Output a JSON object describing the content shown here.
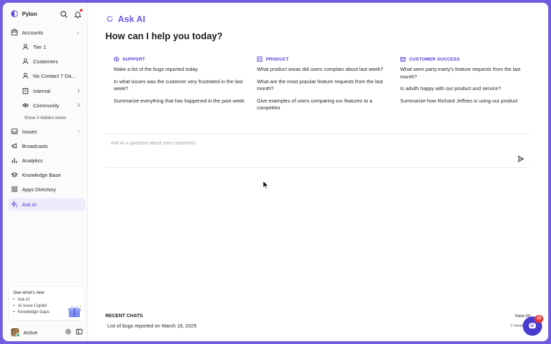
{
  "app": {
    "name": "Pylon"
  },
  "sidebar": {
    "items": [
      {
        "label": "Accounts"
      },
      {
        "label": "Tier 1"
      },
      {
        "label": "Customers"
      },
      {
        "label": "No Contact 7 Da..."
      },
      {
        "label": "Internal",
        "count": "1"
      },
      {
        "label": "Community",
        "count": "3"
      },
      {
        "label": "Issues"
      },
      {
        "label": "Broadcasts"
      },
      {
        "label": "Analytics"
      },
      {
        "label": "Knowledge Base"
      },
      {
        "label": "Apps Directory"
      },
      {
        "label": "Ask AI"
      }
    ],
    "hidden_views": "Show 3 hidden views",
    "whats_new": {
      "title": "See what's new",
      "items": [
        "Ask AI",
        "AI Issue Copilot",
        "Knowledge Gaps"
      ]
    },
    "user": {
      "status": "Active"
    }
  },
  "main": {
    "title": "Ask AI",
    "headline": "How can I help you today?",
    "columns": [
      {
        "heading": "SUPPORT",
        "questions": [
          "Make a list of the bugs reported today",
          "In what issues was the customer very frustrated in the last week?",
          "Summarize everything that has happened in the past week"
        ]
      },
      {
        "heading": "PRODUCT",
        "questions": [
          "What product areas did users complain about last week?",
          "What are the most popular feature requests from the last month?",
          "Give examples of users comparing our features to a competitor"
        ]
      },
      {
        "heading": "CUSTOMER SUCCESS",
        "questions": [
          "What were party.marty's feature requests from the last month?",
          "Is advith happy with our product and service?",
          "Summarize how Richard Jeffries is using our product"
        ]
      }
    ],
    "ask_placeholder": "Ask AI a question about your customers",
    "recent": {
      "title": "RECENT CHATS",
      "view_all": "View All",
      "items": [
        {
          "title": "List of bugs reported on March 19, 2025",
          "time": "2 weeks a"
        }
      ]
    }
  },
  "chat_widget": {
    "badge": "15"
  },
  "colors": {
    "accent": "#4a3bd0",
    "frame": "#6f5ce0",
    "badge": "#e53935"
  }
}
